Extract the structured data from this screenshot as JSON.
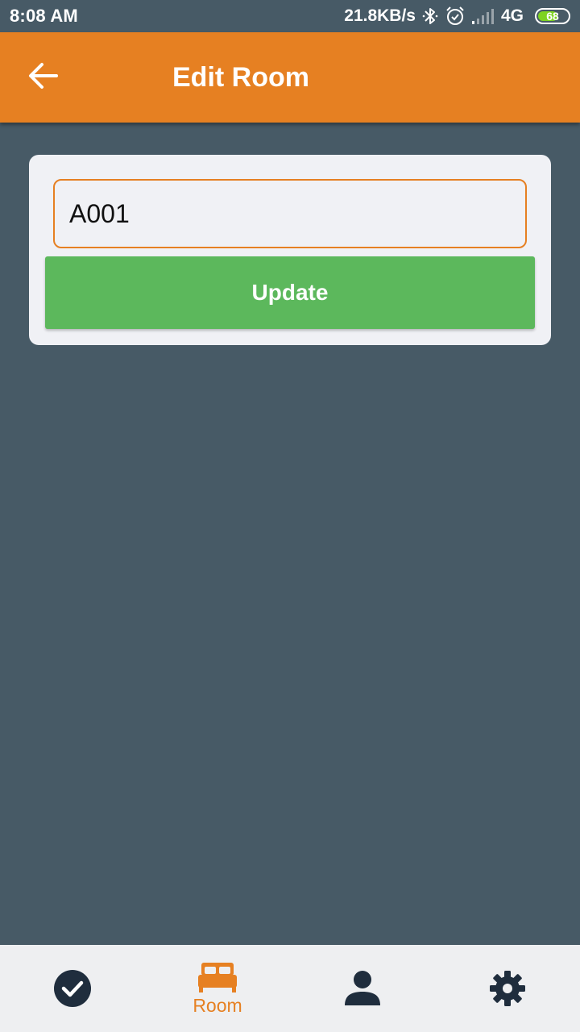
{
  "status_bar": {
    "time": "8:08 AM",
    "net_speed": "21.8KB/s",
    "network_type": "4G",
    "battery_level": "68",
    "battery_percent": 68,
    "icons": [
      "bluetooth-icon",
      "alarm-icon",
      "signal-icon",
      "battery-icon"
    ]
  },
  "app_bar": {
    "title": "Edit Room",
    "back_icon": "arrow-left-icon"
  },
  "form": {
    "room_value": "A001",
    "update_label": "Update"
  },
  "bottom_nav": {
    "items": [
      {
        "icon": "check-circle-icon",
        "label": "",
        "active": false
      },
      {
        "icon": "bed-icon",
        "label": "Room",
        "active": true
      },
      {
        "icon": "person-icon",
        "label": "",
        "active": false
      },
      {
        "icon": "gear-icon",
        "label": "",
        "active": false
      }
    ]
  },
  "colors": {
    "primary": "#e68022",
    "background": "#475a66",
    "card": "#f0f1f5",
    "button": "#5cb85c",
    "nav_icon": "#1f2d3d",
    "caret": "#00897b",
    "battery": "#7ed321"
  }
}
